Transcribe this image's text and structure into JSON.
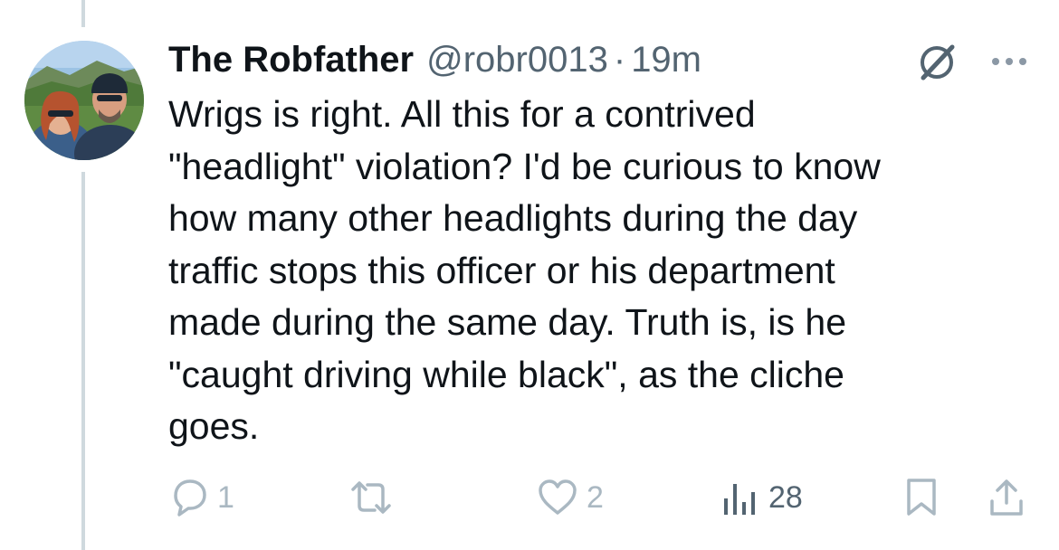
{
  "tweet": {
    "display_name": "The Robfather",
    "handle": "@robr0013",
    "separator": "·",
    "time": "19m",
    "text_lines": [
      "Wrigs is right. All this for a contrived",
      "\"headlight\" violation? I'd be curious to know",
      "how many other headlights during the day",
      "traffic stops this officer or his department",
      "made during the same day. Truth is, is he",
      "\"caught driving while black\", as the cliche",
      "goes."
    ]
  },
  "actions": {
    "replies": "1",
    "reposts": "",
    "likes": "2",
    "views": "28"
  },
  "icons": {
    "header": [
      "grok-icon",
      "more-icon"
    ],
    "actions": [
      "reply-icon",
      "repost-icon",
      "like-icon",
      "views-icon",
      "bookmark-icon",
      "share-icon"
    ]
  },
  "colors": {
    "text": "#0f1419",
    "secondary": "#536471",
    "muted_action": "#aab8c2",
    "thread_line": "#cfd9de",
    "background": "#ffffff"
  }
}
